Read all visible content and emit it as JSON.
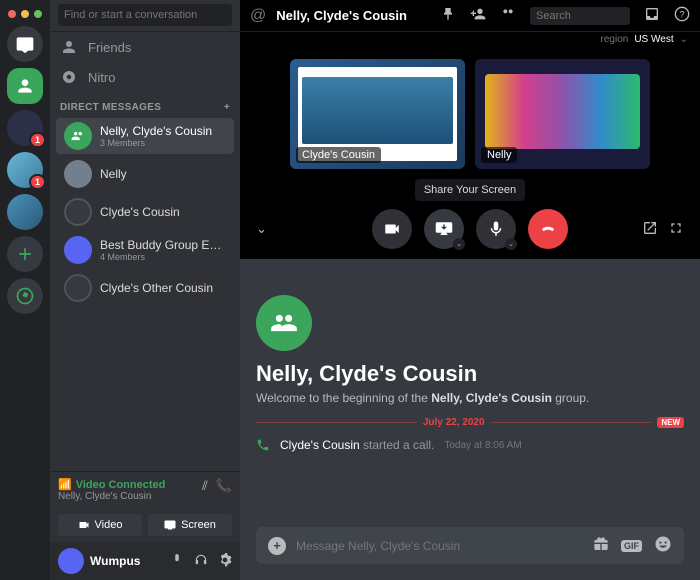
{
  "search_placeholder": "Find or start a conversation",
  "nav": {
    "friends": "Friends",
    "nitro": "Nitro"
  },
  "dm_header": "DIRECT MESSAGES",
  "dms": [
    {
      "name": "Nelly, Clyde's Cousin",
      "sub": "3 Members"
    },
    {
      "name": "Nelly"
    },
    {
      "name": "Clyde's Cousin"
    },
    {
      "name": "Best Buddy Group Ever",
      "sub": "4 Members"
    },
    {
      "name": "Clyde's Other Cousin"
    }
  ],
  "voice": {
    "status": "Video Connected",
    "channel": "Nelly, Clyde's Cousin"
  },
  "buttons": {
    "video": "Video",
    "screen": "Screen"
  },
  "user": {
    "name": "Wumpus"
  },
  "title": "Nelly, Clyde's Cousin",
  "toolbar_search": "Search",
  "region": {
    "label": "region",
    "value": "US West"
  },
  "tiles": [
    {
      "label": "Clyde's Cousin"
    },
    {
      "label": "Nelly"
    }
  ],
  "tooltip": "Share Your Screen",
  "welcome": {
    "title": "Nelly, Clyde's Cousin",
    "pre": "Welcome to the beginning of the ",
    "bold": "Nelly, Clyde's Cousin",
    "post": " group."
  },
  "divider": {
    "date": "July 22, 2020",
    "new": "NEW"
  },
  "call_msg": {
    "author": "Clyde's Cousin",
    "action": " started a call.",
    "time": "Today at 8:06 AM"
  },
  "input_placeholder": "Message Nelly, Clyde's Cousin",
  "gif": "GIF",
  "server_badges": {
    "s3": "1",
    "s4": "1"
  }
}
